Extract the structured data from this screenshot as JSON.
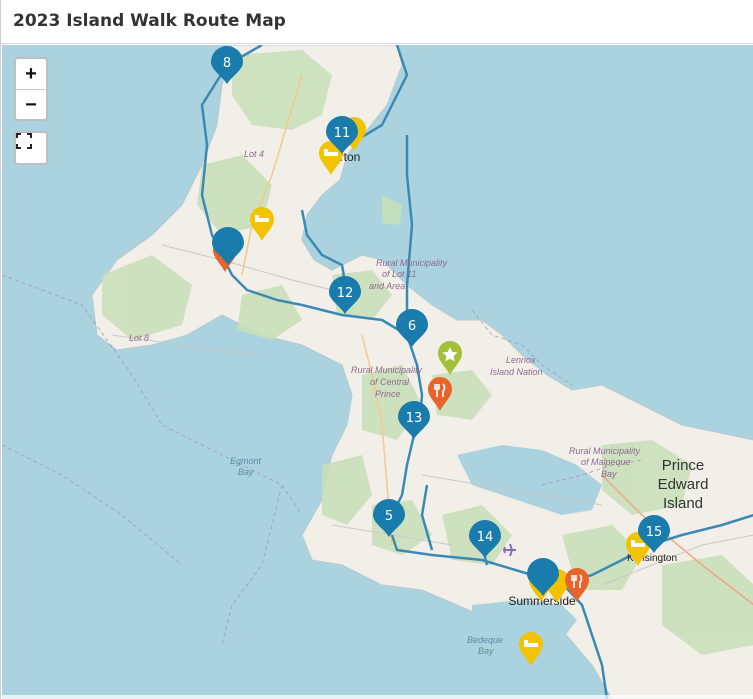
{
  "header": {
    "title": "2023 Island Walk Route Map"
  },
  "controls": {
    "zoom_in": "+",
    "zoom_out": "−"
  },
  "colors": {
    "water": "#aad3df",
    "land": "#f2efe9",
    "forest": "#c8dfb8",
    "route": "#3b8ab5",
    "pin_blue": "#1a7bad",
    "pin_orange": "#e8642a",
    "pin_yellow": "#f2c300",
    "pin_green": "#a2c03a"
  },
  "markers": {
    "stops": [
      "8",
      "11",
      "12",
      "6",
      "13",
      "5",
      "14",
      "15"
    ],
    "icons": {
      "restaurant": "restaurant-icon",
      "lodging": "bed-icon",
      "attraction": "star-icon",
      "airport": "airplane-icon"
    }
  },
  "labels": {
    "alberton": "rton",
    "lot4": "Lot 4",
    "lot8": "Lot 8",
    "rm_lot11": [
      "Rural Municipality",
      "of Lot 11",
      "and Area"
    ],
    "rm_central_prince": [
      "Rural Municipality",
      "of Central",
      "Prince"
    ],
    "lennox": [
      "Lennox",
      "Island Nation"
    ],
    "rm_malpeque": [
      "Rural Municipality",
      "of Malpeque",
      "Bay"
    ],
    "pei": [
      "Prince",
      "Edward",
      "Island"
    ],
    "kensington": "Kensington",
    "summerside": "Summerside",
    "egmont": [
      "Egmont",
      "Bay"
    ],
    "bedeque": [
      "Bedeque",
      "Bay"
    ]
  }
}
